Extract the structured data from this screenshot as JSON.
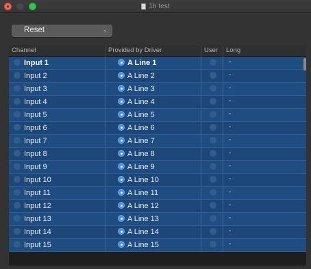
{
  "window": {
    "title": "1h test"
  },
  "toolbar": {
    "popup_value": "Reset",
    "popup_arrow": "⌄"
  },
  "table": {
    "columns": [
      "Channel",
      "Provided by Driver",
      "User",
      "Long"
    ],
    "rows": [
      {
        "channel": "Input 1",
        "driver": "A Line 1",
        "long": "-"
      },
      {
        "channel": "Input 2",
        "driver": "A Line 2",
        "long": "-"
      },
      {
        "channel": "Input 3",
        "driver": "A Line 3",
        "long": "-"
      },
      {
        "channel": "Input 4",
        "driver": "A Line 4",
        "long": "-"
      },
      {
        "channel": "Input 5",
        "driver": "A Line 5",
        "long": "-"
      },
      {
        "channel": "Input 6",
        "driver": "A Line 6",
        "long": "-"
      },
      {
        "channel": "Input 7",
        "driver": "A Line 7",
        "long": "-"
      },
      {
        "channel": "Input 8",
        "driver": "A Line 8",
        "long": "-"
      },
      {
        "channel": "Input 9",
        "driver": "A Line 9",
        "long": "-"
      },
      {
        "channel": "Input 10",
        "driver": "A Line 10",
        "long": "-"
      },
      {
        "channel": "Input 11",
        "driver": "A Line 11",
        "long": "-"
      },
      {
        "channel": "Input 12",
        "driver": "A Line 12",
        "long": "-"
      },
      {
        "channel": "Input 13",
        "driver": "A Line 13",
        "long": "-"
      },
      {
        "channel": "Input 14",
        "driver": "A Line 14",
        "long": "-"
      },
      {
        "channel": "Input 15",
        "driver": "A Line 15",
        "long": "-"
      }
    ]
  }
}
